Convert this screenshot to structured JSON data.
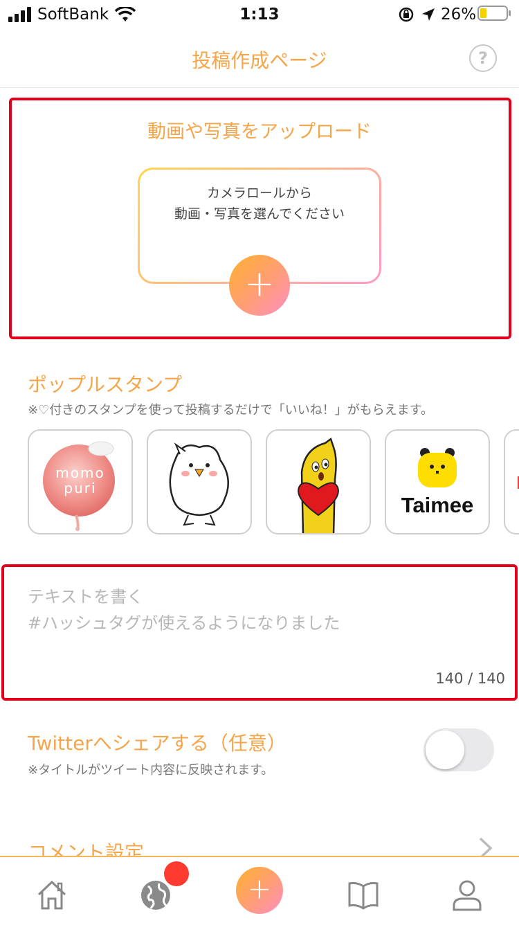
{
  "status_bar": {
    "carrier": "SoftBank",
    "time": "1:13",
    "battery_percent": "26%",
    "battery_level": 0.26
  },
  "header": {
    "title": "投稿作成ページ",
    "help_label": "?"
  },
  "upload": {
    "title": "動画や写真をアップロード",
    "line1": "カメラロールから",
    "line2": "動画・写真を選んでください",
    "plus_label": "+"
  },
  "stamps": {
    "title": "ポップルスタンプ",
    "note": "※♡付きのスタンプを使って投稿するだけで「いいね！」がもらえます。",
    "items": [
      {
        "name": "momo-puri",
        "logo_line1": "momo",
        "logo_line2": "puri"
      },
      {
        "name": "white-bird"
      },
      {
        "name": "banana-heart"
      },
      {
        "name": "taimee",
        "logo_text": "Taimee"
      }
    ]
  },
  "text_input": {
    "placeholder_line1": "テキストを書く",
    "placeholder_line2": "#ハッシュタグが使えるようになりました",
    "counter": "140 / 140"
  },
  "twitter": {
    "title": "Twitterへシェアする（任意）",
    "note": "※タイトルがツイート内容に反映されます。",
    "enabled": false
  },
  "comment_settings": {
    "title": "コメント設定"
  },
  "tab_bar": {
    "items": [
      "home-icon",
      "globe-icon",
      "post-plus-icon",
      "book-icon",
      "profile-icon"
    ],
    "center_label": "+",
    "badge_color": "#ff3b30"
  },
  "colors": {
    "accent": "#f5a54a",
    "highlight": "#e3001b"
  }
}
